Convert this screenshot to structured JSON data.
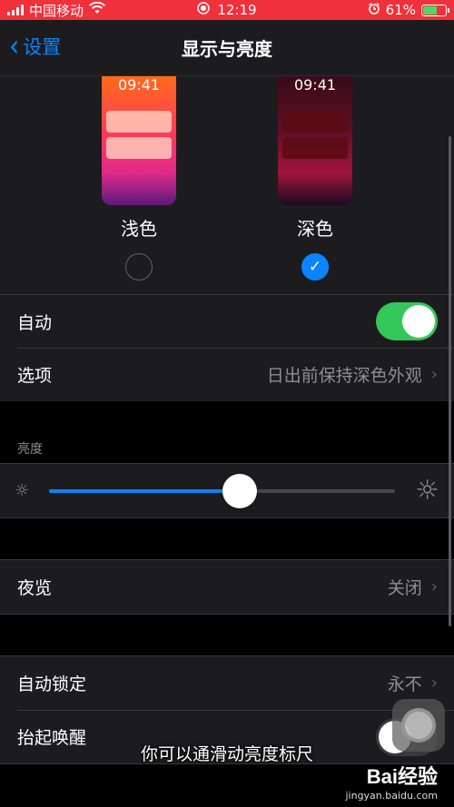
{
  "status_bar": {
    "carrier": "中国移动",
    "time": "12:19",
    "battery_percent": "61%",
    "battery_level": 0.61
  },
  "nav": {
    "back_label": "设置",
    "title": "显示与亮度"
  },
  "appearance": {
    "light": {
      "time": "09:41",
      "label": "浅色",
      "selected": false
    },
    "dark": {
      "time": "09:41",
      "label": "深色",
      "selected": true
    }
  },
  "rows": {
    "auto_label": "自动",
    "auto_on": true,
    "options_label": "选项",
    "options_value": "日出前保持深色外观"
  },
  "brightness": {
    "header": "亮度",
    "level": 0.55
  },
  "night_shift": {
    "label": "夜览",
    "value": "关闭"
  },
  "auto_lock": {
    "label": "自动锁定",
    "value": "永不"
  },
  "raise_to_wake": {
    "label": "抬起唤醒",
    "on": false
  },
  "overlay": {
    "caption": "你可以通滑动亮度标尺",
    "watermark_logo": "Bai经验",
    "watermark_url": "jingyan.baidu.com"
  },
  "colors": {
    "accent": "#0a84ff",
    "toggle_on": "#34c759",
    "status_bar": "#f0303a"
  }
}
